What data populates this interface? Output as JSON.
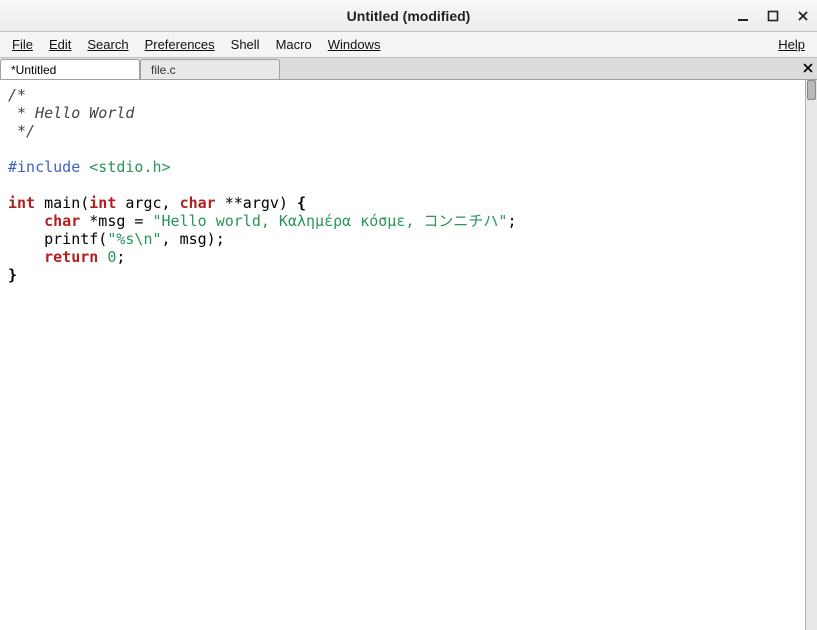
{
  "window": {
    "title": "Untitled (modified)"
  },
  "menu": {
    "file": "File",
    "edit": "Edit",
    "search": "Search",
    "preferences": "Preferences",
    "shell": "Shell",
    "macro": "Macro",
    "windows": "Windows",
    "help": "Help"
  },
  "tabs": {
    "active": "*Untitled",
    "second": "file.c"
  },
  "code": {
    "c1": "/*",
    "c2": " * Hello World",
    "c3": " */",
    "pp": "#include ",
    "inc": "<stdio.h>",
    "kw_int1": "int",
    "main": " main(",
    "kw_int2": "int",
    "argc": " argc, ",
    "kw_char1": "char",
    "argv": " **argv) ",
    "brace_open": "{",
    "indent": "    ",
    "kw_char2": "char",
    "msg_decl": " *msg = ",
    "str_msg": "\"Hello world, Καλημέρα κόσμε, コンニチハ\"",
    "semi": ";",
    "printf": "    printf(",
    "str_fmt": "\"%s\\n\"",
    "printf_end": ", msg);",
    "kw_return": "return",
    "sp": " ",
    "zero": "0",
    "brace_close": "}"
  }
}
